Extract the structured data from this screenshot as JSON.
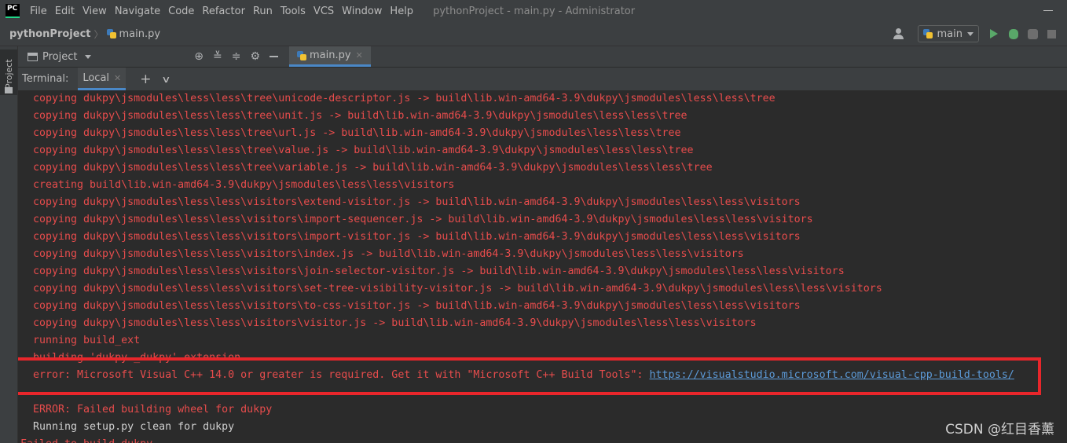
{
  "menu": {
    "logo": "PC",
    "items": [
      "File",
      "Edit",
      "View",
      "Navigate",
      "Code",
      "Refactor",
      "Run",
      "Tools",
      "VCS",
      "Window",
      "Help"
    ],
    "window_title": "pythonProject - main.py - Administrator"
  },
  "navbar": {
    "project": "pythonProject",
    "file": "main.py",
    "run_config": "main"
  },
  "project_panel": {
    "stripe_label": "Project",
    "header_label": "Project"
  },
  "editor": {
    "tab_label": "main.py"
  },
  "terminal": {
    "label": "Terminal:",
    "tab_label": "Local",
    "lines": [
      "copying dukpy\\jsmodules\\less\\less\\tree\\unicode-descriptor.js -> build\\lib.win-amd64-3.9\\dukpy\\jsmodules\\less\\less\\tree",
      "copying dukpy\\jsmodules\\less\\less\\tree\\unit.js -> build\\lib.win-amd64-3.9\\dukpy\\jsmodules\\less\\less\\tree",
      "copying dukpy\\jsmodules\\less\\less\\tree\\url.js -> build\\lib.win-amd64-3.9\\dukpy\\jsmodules\\less\\less\\tree",
      "copying dukpy\\jsmodules\\less\\less\\tree\\value.js -> build\\lib.win-amd64-3.9\\dukpy\\jsmodules\\less\\less\\tree",
      "copying dukpy\\jsmodules\\less\\less\\tree\\variable.js -> build\\lib.win-amd64-3.9\\dukpy\\jsmodules\\less\\less\\tree",
      "creating build\\lib.win-amd64-3.9\\dukpy\\jsmodules\\less\\less\\visitors",
      "copying dukpy\\jsmodules\\less\\less\\visitors\\extend-visitor.js -> build\\lib.win-amd64-3.9\\dukpy\\jsmodules\\less\\less\\visitors",
      "copying dukpy\\jsmodules\\less\\less\\visitors\\import-sequencer.js -> build\\lib.win-amd64-3.9\\dukpy\\jsmodules\\less\\less\\visitors",
      "copying dukpy\\jsmodules\\less\\less\\visitors\\import-visitor.js -> build\\lib.win-amd64-3.9\\dukpy\\jsmodules\\less\\less\\visitors",
      "copying dukpy\\jsmodules\\less\\less\\visitors\\index.js -> build\\lib.win-amd64-3.9\\dukpy\\jsmodules\\less\\less\\visitors",
      "copying dukpy\\jsmodules\\less\\less\\visitors\\join-selector-visitor.js -> build\\lib.win-amd64-3.9\\dukpy\\jsmodules\\less\\less\\visitors",
      "copying dukpy\\jsmodules\\less\\less\\visitors\\set-tree-visibility-visitor.js -> build\\lib.win-amd64-3.9\\dukpy\\jsmodules\\less\\less\\visitors",
      "copying dukpy\\jsmodules\\less\\less\\visitors\\to-css-visitor.js -> build\\lib.win-amd64-3.9\\dukpy\\jsmodules\\less\\less\\visitors",
      "copying dukpy\\jsmodules\\less\\less\\visitors\\visitor.js -> build\\lib.win-amd64-3.9\\dukpy\\jsmodules\\less\\less\\visitors",
      "running build_ext",
      "building 'dukpy._dukpy' extension"
    ],
    "error_line_prefix": "error: Microsoft Visual C++ 14.0 or greater is required. Get it with \"Microsoft C++ Build Tools\": ",
    "error_link": "https://visualstudio.microsoft.com/visual-cpp-build-tools/",
    "tail_lines": [
      "ERROR: Failed building wheel for dukpy",
      "Running setup.py clean for dukpy",
      "Failed to build dukpy"
    ]
  },
  "watermark": "CSDN @红目香薰",
  "colors": {
    "background": "#2b2b2b",
    "chrome": "#3c3f41",
    "error_text": "#e74c4c",
    "link": "#5c9bd9",
    "highlight_box": "#e8262b",
    "tab_underline": "#4a88c7"
  }
}
